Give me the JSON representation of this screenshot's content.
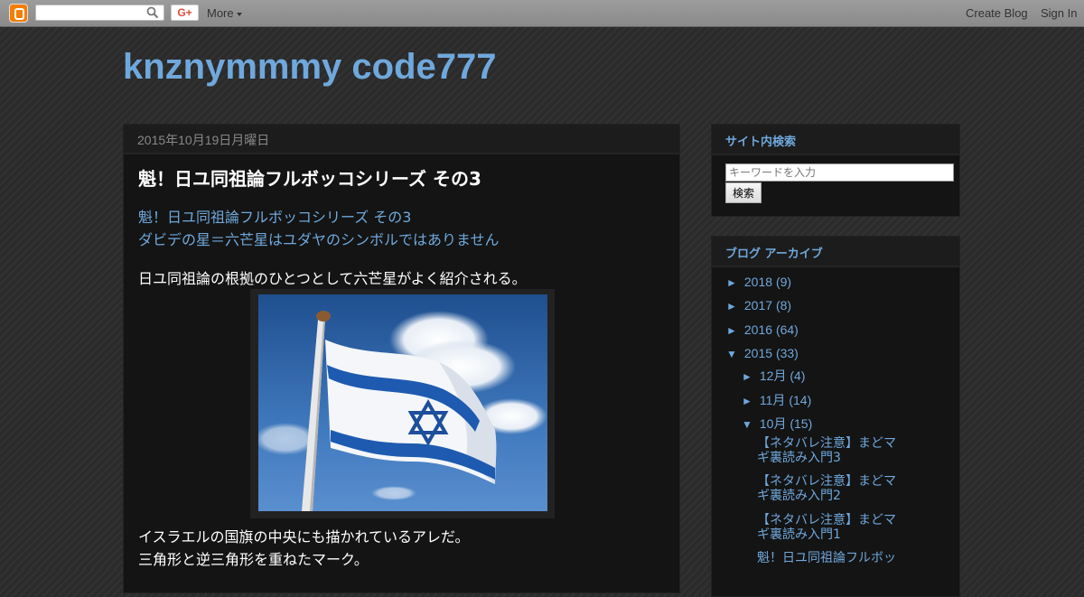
{
  "navbar": {
    "more_label": "More",
    "gplus_label": "G+",
    "create_blog_label": "Create Blog",
    "sign_in_label": "Sign In"
  },
  "header": {
    "blog_title": "knznymmmy code777"
  },
  "post": {
    "date": "2015年10月19日月曜日",
    "title": "魁！日ユ同祖論フルボッコシリーズ その3",
    "link_line_1": "魁！日ユ同祖論フルボッコシリーズ その3",
    "link_line_2": "ダビデの星＝六芒星はユダヤのシンボルではありません",
    "paragraph_1": "日ユ同祖論の根拠のひとつとして六芒星がよく紹介される。",
    "paragraph_2": "イスラエルの国旗の中央にも描かれているアレだ。",
    "paragraph_3": "三角形と逆三角形を重ねたマーク。"
  },
  "sidebar": {
    "search": {
      "title": "サイト内検索",
      "placeholder": "キーワードを入力",
      "button_label": "検索"
    },
    "archive": {
      "title": "ブログ アーカイブ",
      "collapsed_toggle": "►",
      "expanded_toggle": "▼",
      "years": [
        {
          "label": "2018",
          "count": "(9)"
        },
        {
          "label": "2017",
          "count": "(8)"
        },
        {
          "label": "2016",
          "count": "(64)"
        },
        {
          "label": "2015",
          "count": "(33)"
        }
      ],
      "months": [
        {
          "label": "12月",
          "count": "(4)"
        },
        {
          "label": "11月",
          "count": "(14)"
        },
        {
          "label": "10月",
          "count": "(15)"
        }
      ],
      "posts": [
        "【ネタバレ注意】まどマギ裏読み入門3",
        "【ネタバレ注意】まどマギ裏読み入門2",
        "【ネタバレ注意】まどマギ裏読み入門1",
        "魁！日ユ同祖論フルボッ"
      ]
    }
  }
}
